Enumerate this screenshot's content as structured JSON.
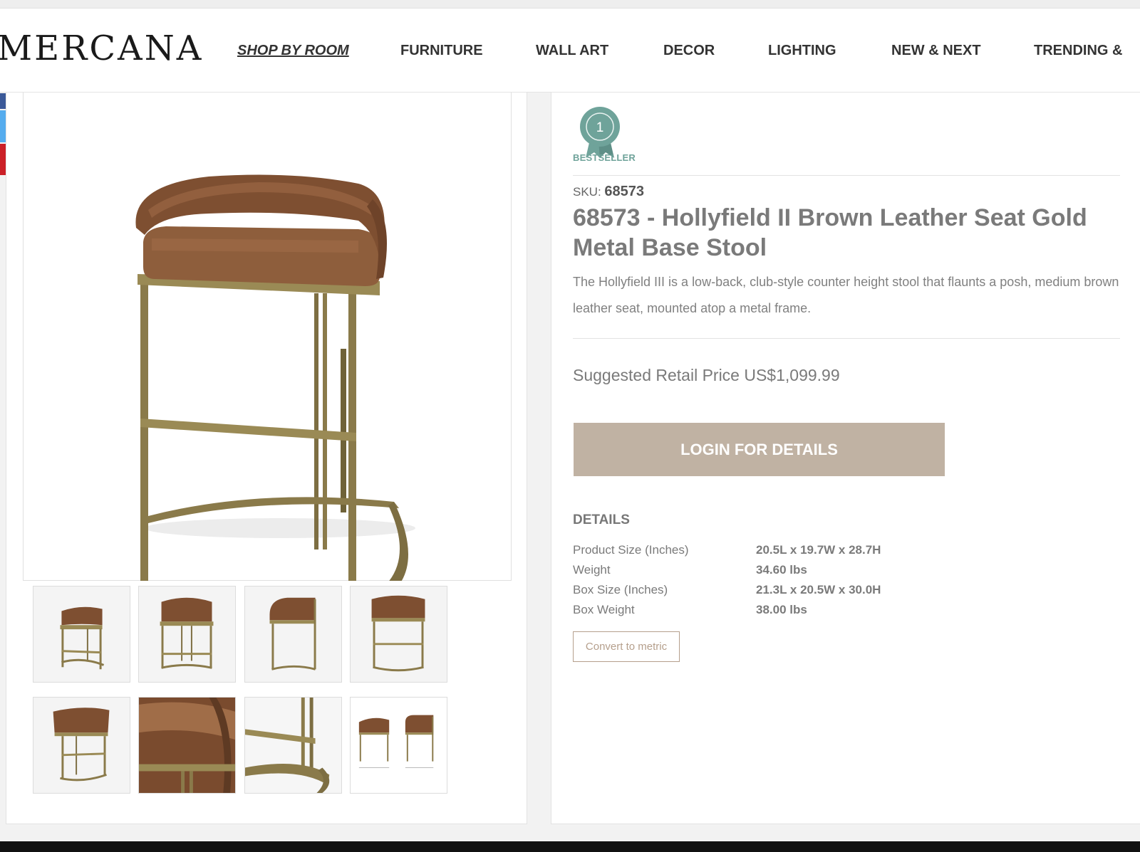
{
  "brand": {
    "logo_text": "MERCANA"
  },
  "nav": {
    "items": [
      {
        "label": "SHOP BY ROOM",
        "active": true
      },
      {
        "label": "FURNITURE"
      },
      {
        "label": "WALL ART"
      },
      {
        "label": "DECOR"
      },
      {
        "label": "LIGHTING"
      },
      {
        "label": "NEW & NEXT"
      },
      {
        "label": "TRENDING &"
      }
    ]
  },
  "social": {
    "colors": [
      "#3b5998",
      "#55acee",
      "#cb2027"
    ]
  },
  "gallery": {
    "main_image_icon": "bar-stool-image",
    "thumbnails": [
      {
        "icon": "stool-angle-view"
      },
      {
        "icon": "stool-front-view"
      },
      {
        "icon": "stool-side-view"
      },
      {
        "icon": "stool-back-view"
      },
      {
        "icon": "stool-rear-angle-view"
      },
      {
        "icon": "seat-closeup"
      },
      {
        "icon": "base-closeup"
      },
      {
        "icon": "dimension-diagram"
      }
    ]
  },
  "product": {
    "badge_label": "BESTSELLER",
    "badge_number": "1",
    "sku_label": "SKU:",
    "sku_value": "68573",
    "title": "68573 - Hollyfield II Brown Leather Seat Gold Metal Base Stool",
    "description": "The Hollyfield III is a low-back, club-style counter height stool that flaunts a posh, medium brown leather seat, mounted atop a metal frame.",
    "price": "Suggested Retail Price US$1,099.99",
    "login_button": "LOGIN FOR DETAILS",
    "details_heading": "DETAILS",
    "specs": [
      {
        "label": "Product Size (Inches)",
        "value": "20.5L x 19.7W x 28.7H"
      },
      {
        "label": "Weight",
        "value": "34.60 lbs"
      },
      {
        "label": "Box Size (Inches)",
        "value": "21.3L x 20.5W x 30.0H"
      },
      {
        "label": "Box Weight",
        "value": "38.00 lbs"
      }
    ],
    "convert_button": "Convert to metric"
  },
  "colors": {
    "accent_button": "#c0b2a3",
    "badge_teal": "#6fa39a",
    "leather": "#8a5a3a",
    "metal": "#8a7a4a"
  }
}
